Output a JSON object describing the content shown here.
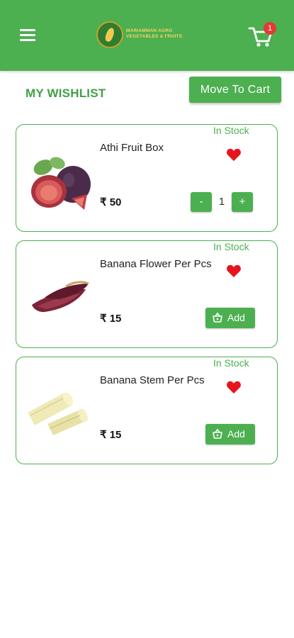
{
  "header": {
    "logo_line1": "MARIAMMAN AGRO",
    "logo_line2": "VEGETABLES & FRUITS",
    "cart_count": "1",
    "colors": {
      "primary": "#4caf50",
      "badge": "#e53935"
    }
  },
  "page": {
    "title": "MY WISHLIST",
    "move_to_cart": "Move To Cart"
  },
  "items": [
    {
      "name": "Athi Fruit Box",
      "stock": "In Stock",
      "price": "₹ 50",
      "qty": "1",
      "minus": "-",
      "plus": "+",
      "image_icon": "fig-fruit-icon"
    },
    {
      "name": "Banana Flower Per Pcs",
      "stock": "In Stock",
      "price": "₹ 15",
      "add_label": "Add",
      "image_icon": "banana-flower-icon"
    },
    {
      "name": "Banana Stem Per Pcs",
      "stock": "In Stock",
      "price": "₹ 15",
      "add_label": "Add",
      "image_icon": "banana-stem-icon"
    }
  ]
}
